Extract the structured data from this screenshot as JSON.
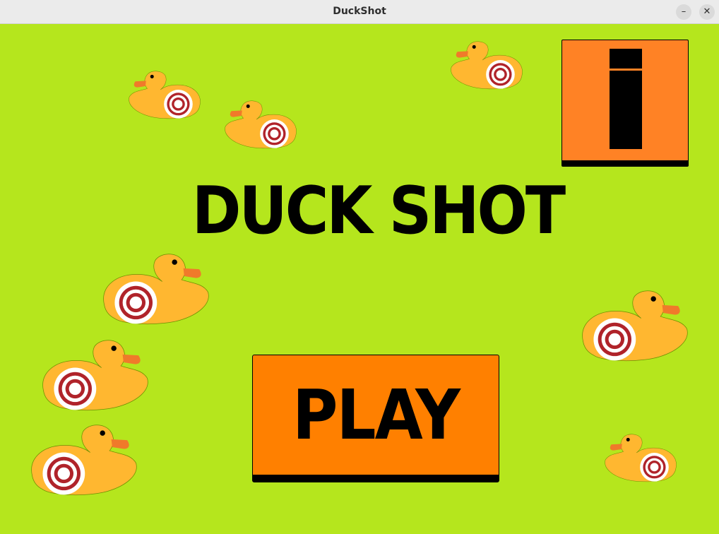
{
  "window": {
    "title": "DuckShot",
    "minimize_symbol": "–",
    "close_symbol": "✕"
  },
  "game": {
    "title": "DUCK SHOT",
    "play_label": "PLAY",
    "info_icon": "info-icon"
  },
  "colors": {
    "background": "#b5e61d",
    "duck_body": "#ffb730",
    "duck_beak": "#f07a2a",
    "target_ring": "#b0232a",
    "play_button": "#ff8000",
    "info_button": "#ff8225"
  }
}
